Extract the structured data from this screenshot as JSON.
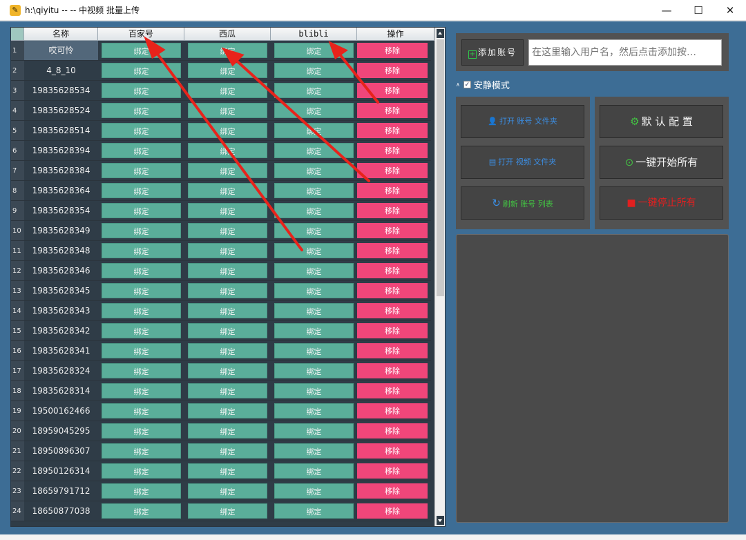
{
  "window": {
    "title": "h:\\qiyitu -- -- 中视频 批量上传",
    "minimize": "—",
    "maximize": "☐",
    "close": "✕"
  },
  "table": {
    "headers": [
      "名称",
      "百家号",
      "西瓜",
      "blibli",
      "操作"
    ],
    "bind_label": "绑定",
    "remove_label": "移除",
    "rows": [
      {
        "num": "1",
        "name": "哎可怜"
      },
      {
        "num": "2",
        "name": "4_8_10"
      },
      {
        "num": "3",
        "name": "19835628534"
      },
      {
        "num": "4",
        "name": "19835628524"
      },
      {
        "num": "5",
        "name": "19835628514"
      },
      {
        "num": "6",
        "name": "19835628394"
      },
      {
        "num": "7",
        "name": "19835628384"
      },
      {
        "num": "8",
        "name": "19835628364"
      },
      {
        "num": "9",
        "name": "19835628354"
      },
      {
        "num": "10",
        "name": "19835628349"
      },
      {
        "num": "11",
        "name": "19835628348"
      },
      {
        "num": "12",
        "name": "19835628346"
      },
      {
        "num": "13",
        "name": "19835628345"
      },
      {
        "num": "14",
        "name": "19835628343"
      },
      {
        "num": "15",
        "name": "19835628342"
      },
      {
        "num": "16",
        "name": "19835628341"
      },
      {
        "num": "17",
        "name": "19835628324"
      },
      {
        "num": "18",
        "name": "19835628314"
      },
      {
        "num": "19",
        "name": "19500162466"
      },
      {
        "num": "20",
        "name": "18959045295"
      },
      {
        "num": "21",
        "name": "18950896307"
      },
      {
        "num": "22",
        "name": "18950126314"
      },
      {
        "num": "23",
        "name": "18659791712"
      },
      {
        "num": "24",
        "name": "18650877038"
      }
    ]
  },
  "add_account": {
    "button_label": "添加账号",
    "placeholder": "在这里输入用户名，然后点击添加按…"
  },
  "quiet_mode": {
    "label": "安静模式",
    "checked": true
  },
  "actions": {
    "open_account_folder": "打开 账号 文件夹",
    "open_video_folder": "打开 视频 文件夹",
    "refresh_list": "刷新 账号 列表",
    "default_config": "默 认 配 置",
    "start_all": "一键开始所有",
    "stop_all": "一键停止所有"
  },
  "colors": {
    "window_bg": "#3d6d95",
    "bind_button": "#5aae9a",
    "remove_button": "#f0467a",
    "panel": "#525252"
  }
}
